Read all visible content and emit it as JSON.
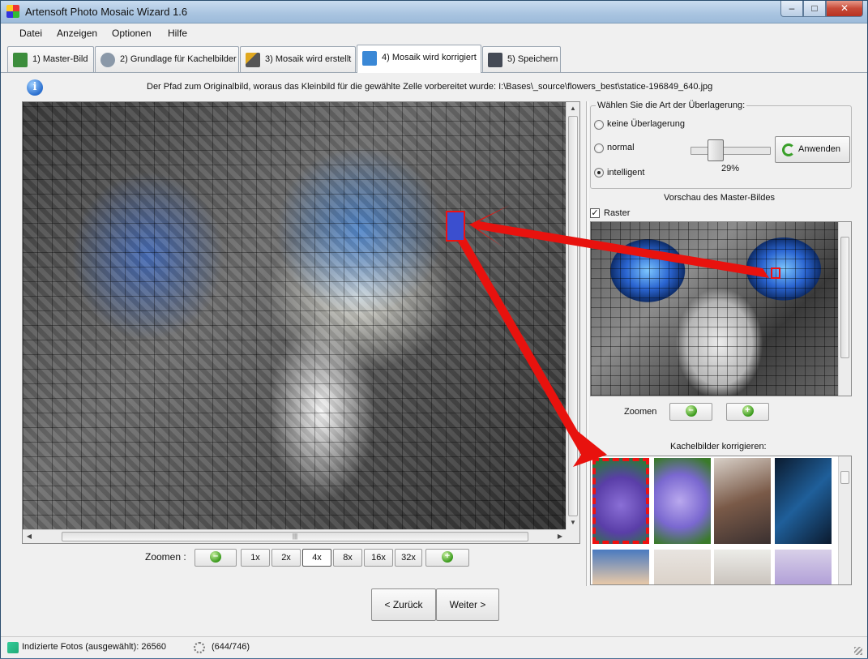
{
  "window": {
    "title": "Artensoft Photo Mosaic Wizard 1.6"
  },
  "menu": [
    "Datei",
    "Anzeigen",
    "Optionen",
    "Hilfe"
  ],
  "tabs": [
    {
      "label": "1) Master-Bild",
      "icon": "image-icon",
      "color": "#3c8d3c"
    },
    {
      "label": "2) Grundlage für Kachelbilder",
      "icon": "database-add-icon",
      "color": "#8a98a8"
    },
    {
      "label": "3) Mosaik wird erstellt",
      "icon": "magic-wand-icon",
      "color": "#e0a820"
    },
    {
      "label": "4) Mosaik wird korrigiert",
      "icon": "cube-icon",
      "color": "#3a88d6",
      "active": true
    },
    {
      "label": "5) Speichern",
      "icon": "floppy-disk-icon",
      "color": "#444a55"
    }
  ],
  "info": {
    "text": "Der Pfad zum Originalbild, woraus das Kleinbild für die gewählte Zelle vorbereitet wurde: I:\\Bases\\_source\\flowers_best\\statice-196849_640.jpg"
  },
  "mosaic_zoom": {
    "label": "Zoomen  :",
    "levels": [
      "1x",
      "2x",
      "4x",
      "8x",
      "16x",
      "32x"
    ],
    "selected": "4x"
  },
  "navigation": {
    "back": "< Zurück",
    "next": "Weiter >"
  },
  "overlay": {
    "group_title": "Wählen Sie die Art der Überlagerung:",
    "options": [
      "keine Überlagerung",
      "normal",
      "intelligent"
    ],
    "selected": "intelligent",
    "percent": 29,
    "percent_label": "29%",
    "apply_label": "Anwenden"
  },
  "preview": {
    "title": "Vorschau des Master-Bildes",
    "grid_label": "Raster",
    "grid_checked": true,
    "zoom_label": "Zoomen"
  },
  "tiles": {
    "title": "Kachelbilder korrigieren:"
  },
  "status": {
    "indexed": "Indizierte Fotos (ausgewählt): 26560",
    "progress": "(644/746)"
  },
  "colors": {
    "accent_red": "#e8120e",
    "selected_tab": "#ffffff"
  }
}
